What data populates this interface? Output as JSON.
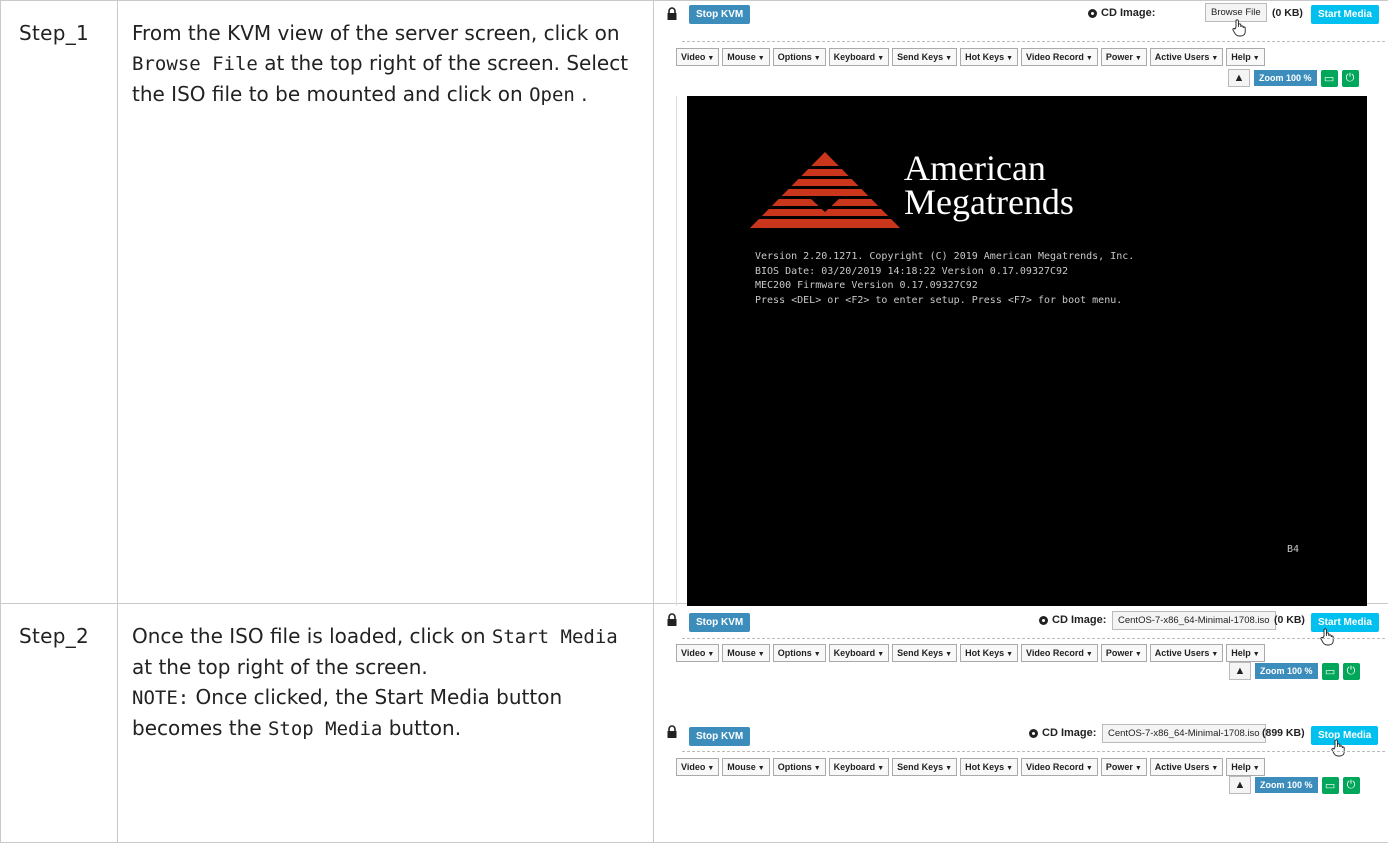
{
  "steps": [
    {
      "label": "Step_1",
      "desc_parts": [
        "From the KVM view of the server screen, click on ",
        "Browse File",
        " at the top right of the screen. Select the ISO file to be mounted and click on ",
        "Open",
        " ."
      ],
      "kvm": {
        "stop_kvm": "Stop KVM",
        "cd_label": "CD Image:",
        "file_button": "Browse File",
        "size": "(0 KB)",
        "media_button": "Start Media",
        "zoom": "Zoom 100 %"
      }
    },
    {
      "label": "Step_2",
      "desc_parts": [
        "Once the ISO file is loaded, click on ",
        "Start Media",
        " at the top right of the screen.",
        "NOTE:",
        " Once clicked, the Start Media button becomes the ",
        "Stop Media",
        " button."
      ],
      "kvm_a": {
        "stop_kvm": "Stop KVM",
        "cd_label": "CD Image:",
        "file_name": "CentOS-7-x86_64-Minimal-1708.iso",
        "size": "(0 KB)",
        "media_button": "Start Media",
        "zoom": "Zoom 100 %"
      },
      "kvm_b": {
        "stop_kvm": "Stop KVM",
        "cd_label": "CD Image:",
        "file_name": "CentOS-7-x86_64-Minimal-1708.iso",
        "size": "(899 KB)",
        "media_button": "Stop Media",
        "zoom": "Zoom 100 %"
      }
    }
  ],
  "menus": [
    "Video",
    "Mouse",
    "Options",
    "Keyboard",
    "Send Keys",
    "Hot Keys",
    "Video Record",
    "Power",
    "Active Users",
    "Help"
  ],
  "screen": {
    "brand_line1": "American",
    "brand_line2": "Megatrends",
    "bios_line1": "Version 2.20.1271. Copyright (C) 2019 American Megatrends, Inc.",
    "bios_line2": "BIOS Date: 03/20/2019 14:18:22 Version 0.17.09327C92",
    "bios_line3": "MEC200 Firmware Version 0.17.09327C92",
    "bios_line4": "Press <DEL> or <F2> to enter setup. Press <F7> for boot menu.",
    "post_code": "B4"
  },
  "colors": {
    "blue_button": "#3c8dbc",
    "cyan_button": "#00c0ef",
    "green_button": "#00a65a",
    "ami_red": "#d2401f"
  },
  "icons": [
    "lock-icon",
    "cd-disc-icon",
    "warning-icon",
    "display-icon",
    "power-icon",
    "hand-pointer-icon"
  ]
}
